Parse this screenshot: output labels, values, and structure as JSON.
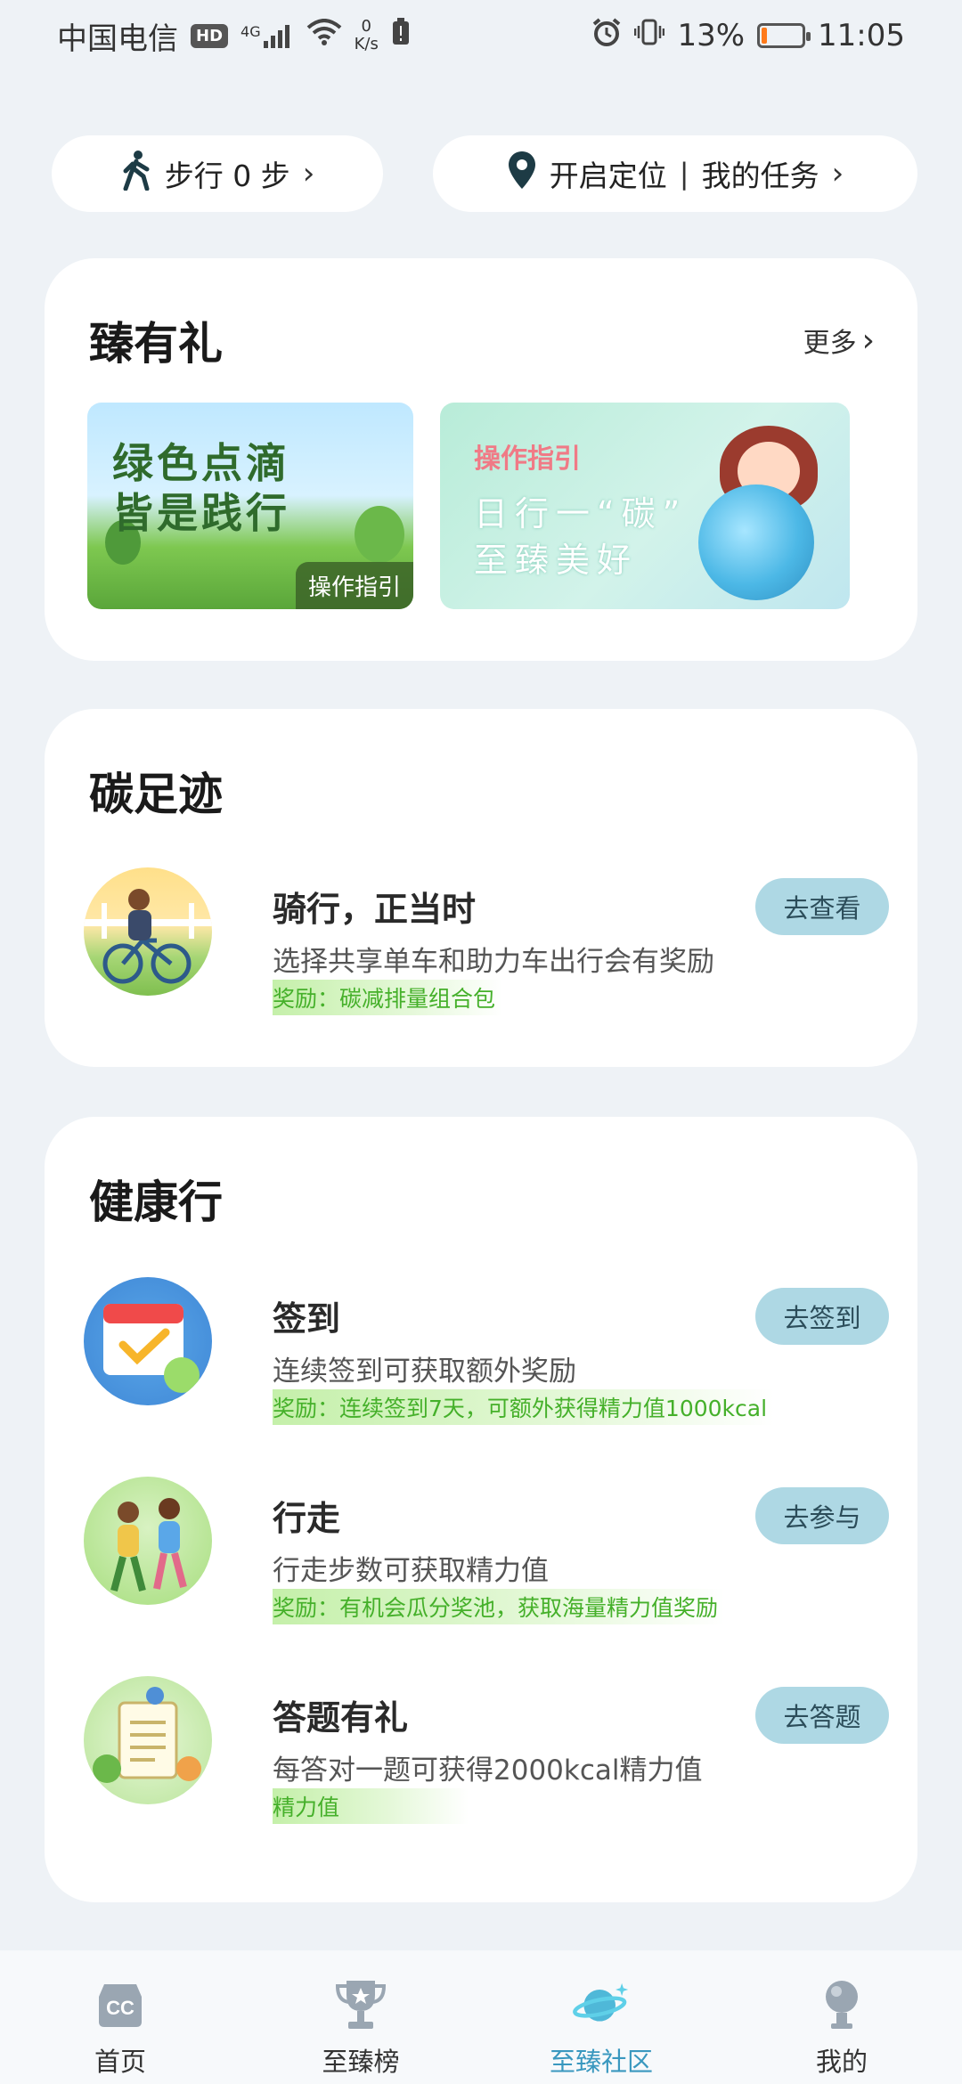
{
  "status_bar": {
    "carrier": "中国电信",
    "hd": "HD",
    "signal": "4G",
    "net_speed_value": "0",
    "net_speed_unit": "K/s",
    "battery_percent": "13%",
    "battery_level": 0.13,
    "time": "11:05"
  },
  "top": {
    "steps_label": "步行 0 步",
    "location_label": "开启定位",
    "separator": "|",
    "tasks_label": "我的任务"
  },
  "gift": {
    "title": "臻有礼",
    "more": "更多",
    "banners": [
      {
        "line1": "绿色点滴",
        "line2": "皆是践行",
        "tag": "操作指引"
      },
      {
        "tag": "操作指引",
        "line1": "日行一“碳”",
        "line2": "至臻美好"
      }
    ]
  },
  "carbon": {
    "title": "碳足迹",
    "tasks": [
      {
        "title": "骑行，正当时",
        "desc": "选择共享单车和助力车出行会有奖励",
        "reward": "奖励：碳减排量组合包",
        "button": "去查看"
      }
    ]
  },
  "health": {
    "title": "健康行",
    "tasks": [
      {
        "title": "签到",
        "desc": "连续签到可获取额外奖励",
        "reward": "奖励：连续签到7天，可额外获得精力值1000kcal",
        "button": "去签到"
      },
      {
        "title": "行走",
        "desc": "行走步数可获取精力值",
        "reward": "奖励：有机会瓜分奖池，获取海量精力值奖励",
        "button": "去参与"
      },
      {
        "title": "答题有礼",
        "desc": "每答对一题可获得2000kcal精力值",
        "reward": "精力值",
        "button": "去答题"
      }
    ]
  },
  "nav": {
    "items": [
      {
        "label": "首页"
      },
      {
        "label": "至臻榜"
      },
      {
        "label": "至臻社区"
      },
      {
        "label": "我的"
      }
    ],
    "active_color": "#3a98bf"
  }
}
